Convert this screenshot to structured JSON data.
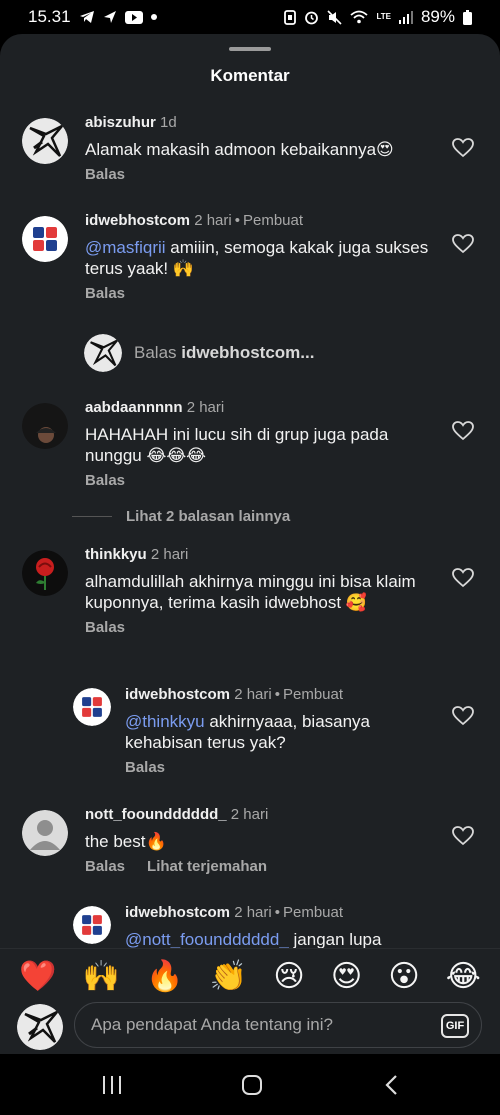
{
  "status_bar": {
    "time": "15.31",
    "battery": "89%",
    "network": "LTE"
  },
  "sheet": {
    "title": "Komentar"
  },
  "comments": [
    {
      "user": "abiszuhur",
      "time": "1d",
      "badge": "",
      "text": "Alamak makasih admoon kebaikannya😍",
      "action": "Balas"
    },
    {
      "user": "idwebhostcom",
      "time": "2 hari",
      "badge": "Pembuat",
      "mention": "@masfiqrii",
      "text": " amiiin, semoga kakak juga sukses terus yaak! 🙌",
      "action": "Balas"
    },
    {
      "user": "aabdaannnnn",
      "time": "2 hari",
      "badge": "",
      "text": "HAHAHAH ini lucu sih di grup juga pada nunggu 😂😂😂",
      "action": "Balas"
    },
    {
      "user": "thinkkyu",
      "time": "2 hari",
      "badge": "",
      "text": "alhamdulillah akhirnya minggu ini bisa klaim kuponnya, terima kasih idwebhost 🥰",
      "action": "Balas"
    },
    {
      "user": "idwebhostcom",
      "time": "2 hari",
      "badge": "Pembuat",
      "mention": "@thinkkyu",
      "text": " akhirnyaaa, biasanya kehabisan terus yak?",
      "action": "Balas"
    },
    {
      "user": "nott_fooundddddd_",
      "time": "2 hari",
      "badge": "",
      "text": "the best🔥",
      "action": "Balas",
      "translate": "Lihat terjemahan"
    },
    {
      "user": "idwebhostcom",
      "time": "2 hari",
      "badge": "Pembuat",
      "mention": "@nott_fooundddddd_",
      "text": " jangan lupa",
      "action": ""
    }
  ],
  "reply_prompt": {
    "prefix": "Balas",
    "user": "idwebhostcom..."
  },
  "more_replies": "Lihat 2 balasan lainnya",
  "emoji_bar": [
    "❤️",
    "🙌",
    "🔥",
    "👏",
    "😢",
    "😍",
    "😮",
    "😂"
  ],
  "input": {
    "placeholder": "Apa pendapat Anda tentang ini?",
    "gif_label": "GIF"
  },
  "colors": {
    "sheet": "#1e2124",
    "mention": "#7b9cf0",
    "muted": "#a8a8a8"
  }
}
